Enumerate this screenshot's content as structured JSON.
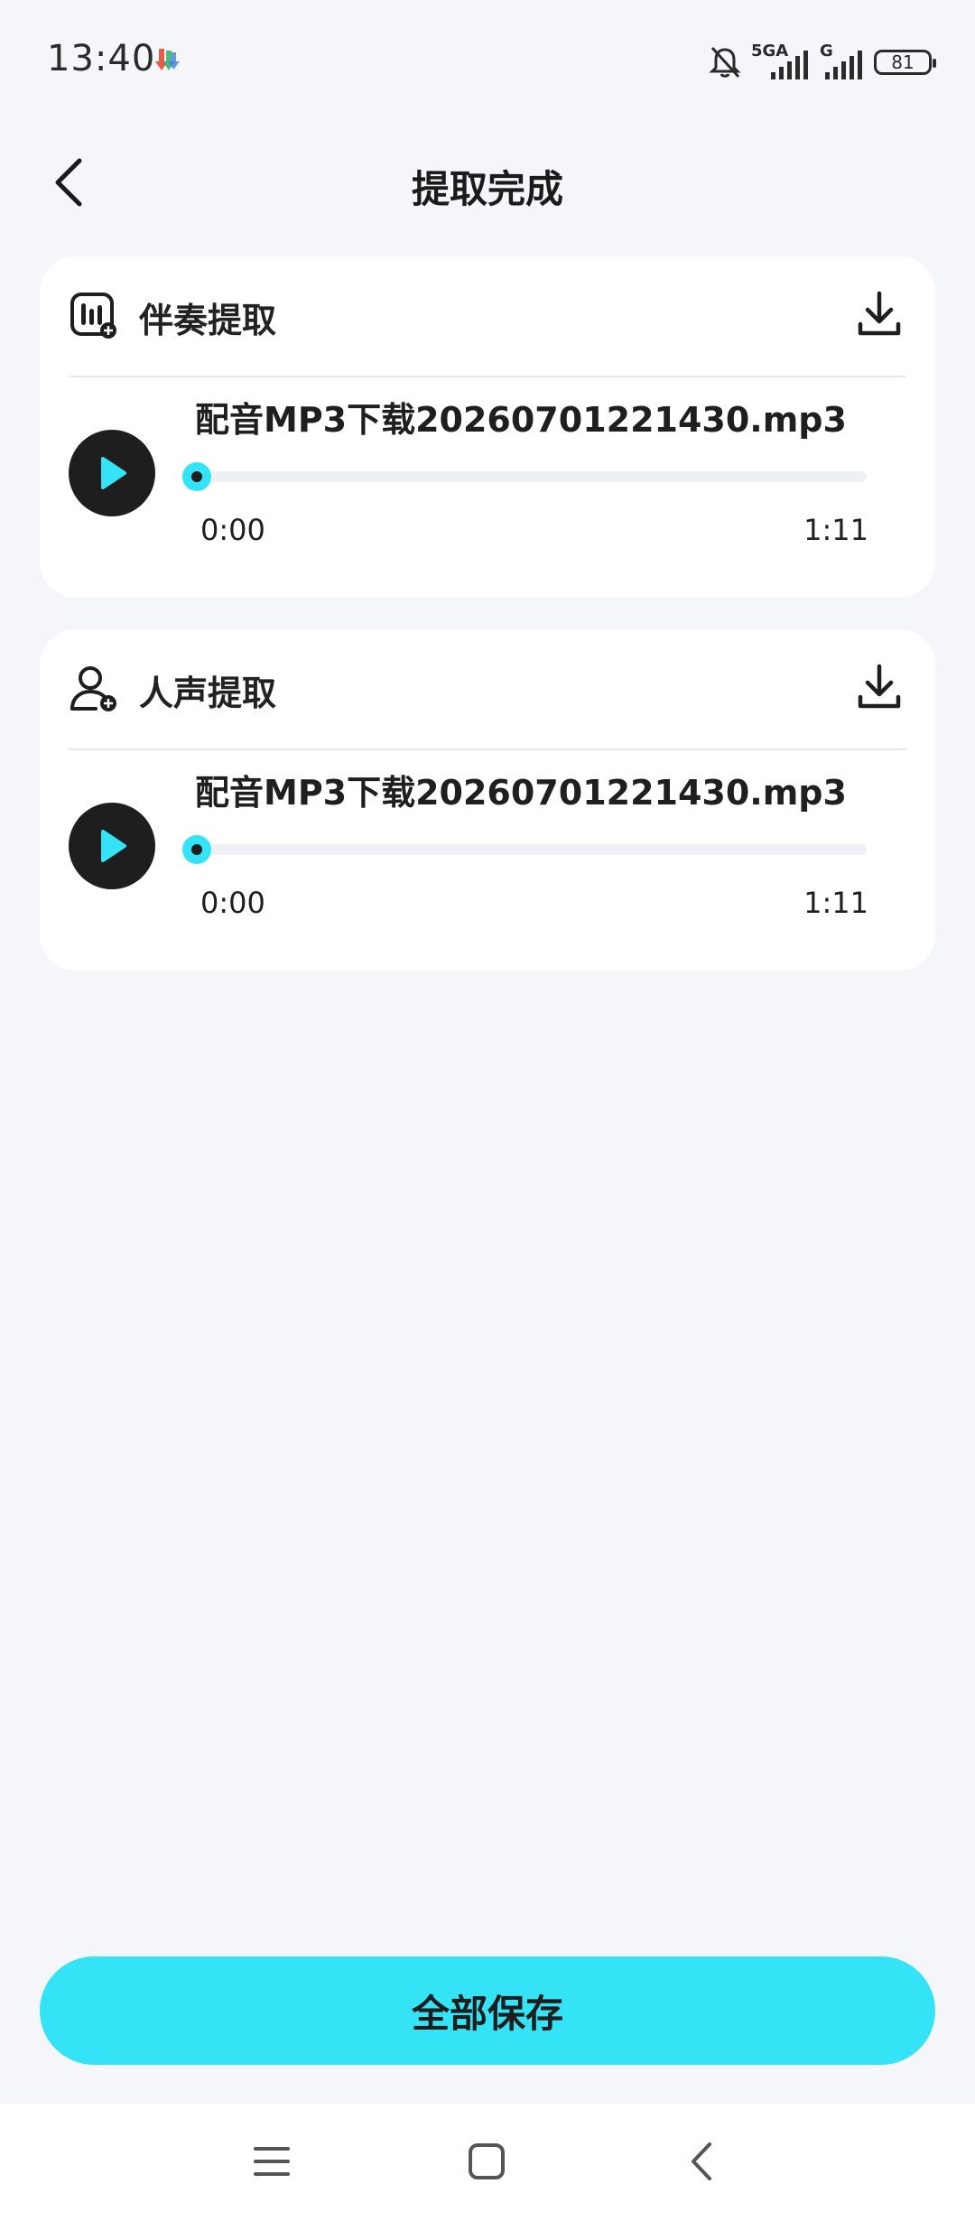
{
  "status_bar": {
    "time": "13:40",
    "network_label": "5GA",
    "network_label_2": "G",
    "battery": "81"
  },
  "header": {
    "title": "提取完成"
  },
  "cards": [
    {
      "title": "伴奏提取",
      "icon": "accompaniment-icon",
      "file_name": "配音MP3下载20260701221430.mp3",
      "current_time": "0:00",
      "total_time": "1:11",
      "progress": 0
    },
    {
      "title": "人声提取",
      "icon": "vocal-icon",
      "file_name": "配音MP3下载20260701221430.mp3",
      "current_time": "0:00",
      "total_time": "1:11",
      "progress": 0
    }
  ],
  "save_all_label": "全部保存",
  "colors": {
    "accent": "#35e3f6",
    "background": "#f4f6fa",
    "card": "#ffffff",
    "dark": "#1e1e1e"
  }
}
